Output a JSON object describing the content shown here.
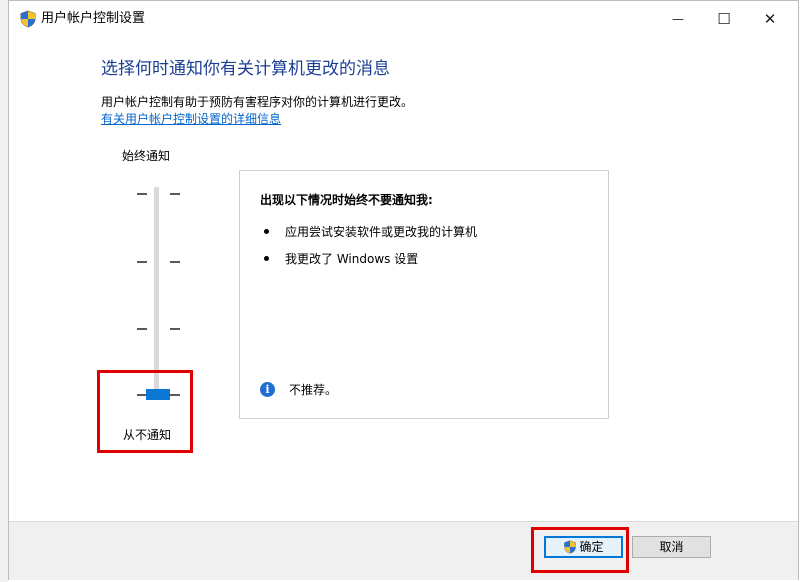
{
  "window": {
    "title": "用户帐户控制设置",
    "minimize_glyph": "—",
    "maximize_glyph": "☐",
    "close_glyph": "✕"
  },
  "main": {
    "heading": "选择何时通知你有关计算机更改的消息",
    "description": "用户帐户控制有助于预防有害程序对你的计算机进行更改。",
    "link": "有关用户帐户控制设置的详细信息"
  },
  "slider": {
    "top_label": "始终通知",
    "bottom_label": "从不通知",
    "levels": 4,
    "selected_level": 0
  },
  "panel": {
    "heading": "出现以下情况时始终不要通知我:",
    "bullets": [
      "应用尝试安装软件或更改我的计算机",
      "我更改了 Windows 设置"
    ],
    "note": "不推荐。"
  },
  "footer": {
    "ok_label": "确定",
    "cancel_label": "取消"
  },
  "colors": {
    "heading": "#1c3f94",
    "link": "#0066cc",
    "slider_thumb": "#0a78d4",
    "highlight": "#e00000",
    "info_icon": "#1f6fd1"
  },
  "icons": {
    "title": "uac-shield-icon",
    "info": "info-icon",
    "ok": "uac-shield-icon"
  }
}
